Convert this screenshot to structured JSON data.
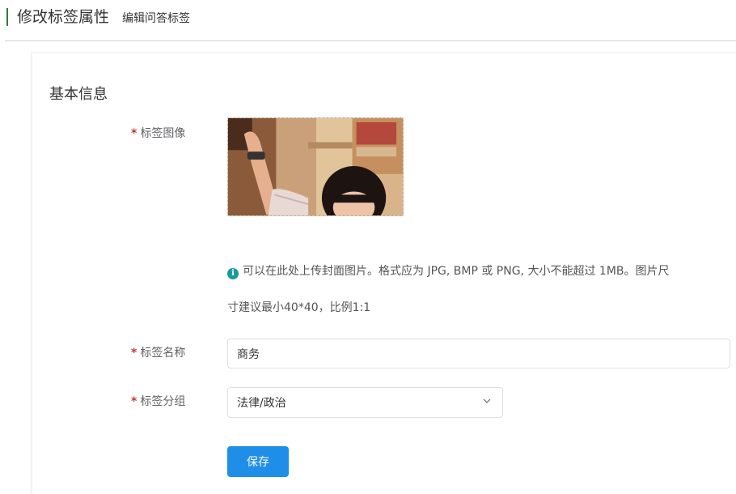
{
  "header": {
    "title": "修改标签属性",
    "subtitle": "编辑问答标签"
  },
  "section": {
    "title": "基本信息"
  },
  "form": {
    "required_mark": "*",
    "image_label": "标签图像",
    "tip_line_1": "可以在此处上传封面图片。格式应为 JPG, BMP 或 PNG, 大小不能超过 1MB。图片尺",
    "tip_line_2": "寸建议最小40*40，比例1:1",
    "name_label": "标签名称",
    "name_value": "商务",
    "group_label": "标签分组",
    "group_value": "法律/政治",
    "save_label": "保存"
  },
  "icons": {
    "info": "info-circle-icon",
    "dropdown": "chevron-down-icon"
  },
  "colors": {
    "accent": "#1e8ee8",
    "header_bar": "#2e7d32",
    "required": "#c0392b",
    "info_icon": "#1a9aa0"
  }
}
